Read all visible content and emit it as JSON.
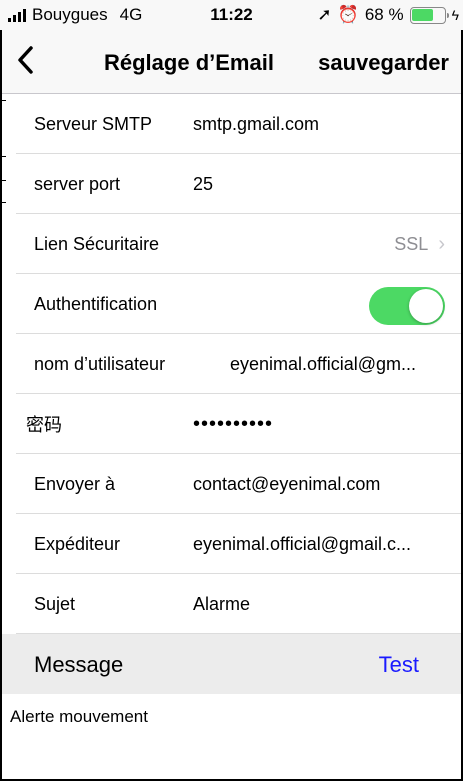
{
  "status_bar": {
    "carrier": "Bouygues",
    "network": "4G",
    "time": "11:22",
    "battery_percent": "68 %",
    "battery_level": 0.68,
    "icons": [
      "signal-icon",
      "location-icon",
      "alarm-icon",
      "battery-icon",
      "charging-icon"
    ]
  },
  "nav": {
    "back_icon": "chevron-left-icon",
    "title": "Réglage d’Email",
    "save_label": "sauvegarder"
  },
  "fields": {
    "smtp": {
      "label": "Serveur SMTP",
      "value": "smtp.gmail.com"
    },
    "port": {
      "label": "server port",
      "value": "25"
    },
    "security": {
      "label": "Lien Sécuritaire",
      "value": "SSL"
    },
    "auth": {
      "label": "Authentification",
      "enabled": true
    },
    "username": {
      "label": "nom d’utilisateur",
      "value": "eyenimal.official@gm..."
    },
    "password": {
      "label": "密码",
      "value": "••••••••••"
    },
    "send_to": {
      "label": "Envoyer à",
      "value": "contact@eyenimal.com"
    },
    "sender": {
      "label": "Expéditeur",
      "value": "eyenimal.official@gmail.c..."
    },
    "subject": {
      "label": "Sujet",
      "value": "Alarme"
    }
  },
  "message": {
    "header_label": "Message",
    "test_label": "Test",
    "body": "Alerte mouvement"
  },
  "colors": {
    "accent_toggle": "#4cd964",
    "link": "#1a1aff",
    "secondary_text": "#8e8e93"
  }
}
